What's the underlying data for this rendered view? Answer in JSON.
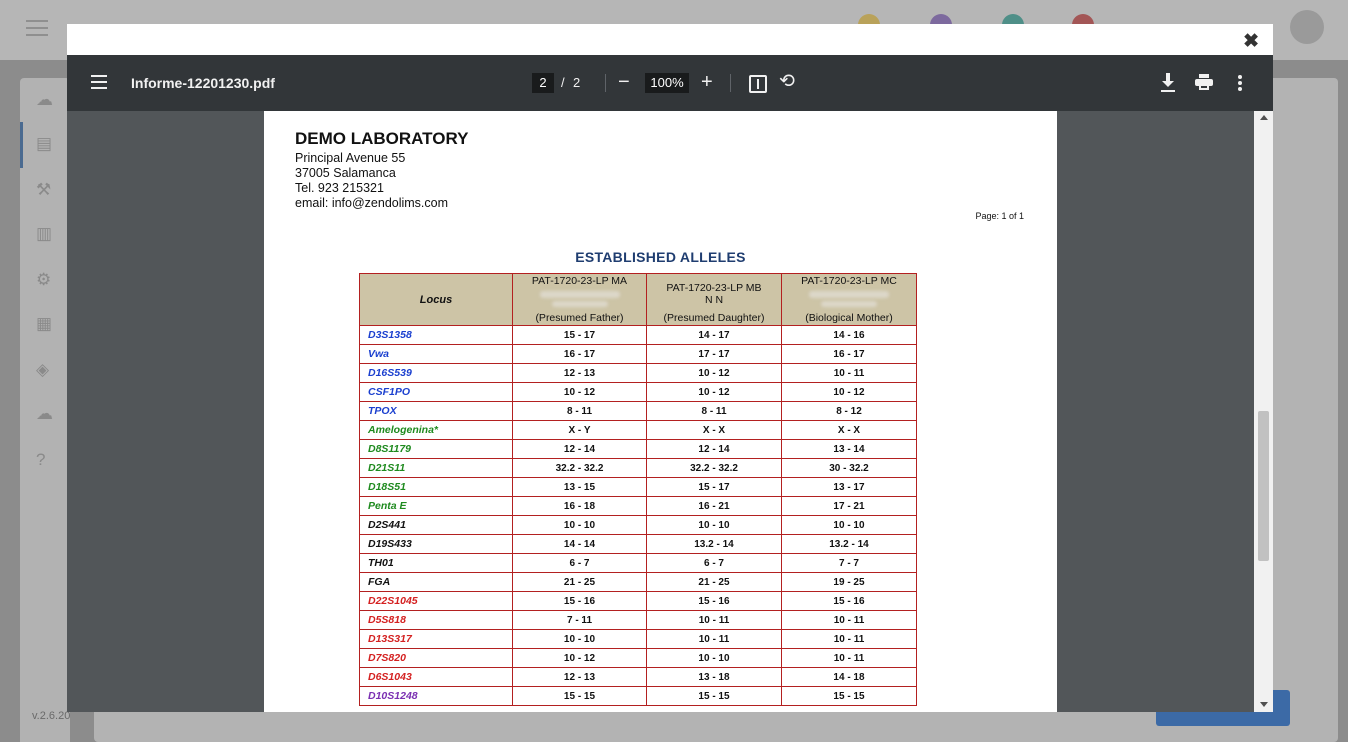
{
  "app": {
    "version": "v.2.6.20"
  },
  "viewer": {
    "file_name": "Informe-12201230.pdf",
    "current_page": "2",
    "page_separator": "/",
    "total_pages": "2",
    "zoom": "100%",
    "zoom_out_label": "−",
    "zoom_in_label": "+",
    "rotate_label": "⟲",
    "modal_close_label": "✖"
  },
  "document": {
    "lab_name": "DEMO LABORATORY",
    "address_line1": "Principal Avenue 55",
    "address_line2": "37005 Salamanca",
    "phone": "Tel. 923 215321",
    "email": "email: info@zendolims.com",
    "page_indicator": "Page: 1 of 1",
    "title": "ESTABLISHED ALLELES",
    "table": {
      "locus_header": "Locus",
      "columns": [
        {
          "sample_id": "PAT-1720-23-LP MA",
          "subline": "",
          "role": "(Presumed Father)"
        },
        {
          "sample_id": "PAT-1720-23-LP MB",
          "subline": "N N",
          "role": "(Presumed Daughter)"
        },
        {
          "sample_id": "PAT-1720-23-LP MC",
          "subline": "",
          "role": "(Biological Mother)"
        }
      ],
      "rows": [
        {
          "locus": "D3S1358",
          "color": "blue",
          "values": [
            "15 - 17",
            "14 - 17",
            "14 - 16"
          ]
        },
        {
          "locus": "Vwa",
          "color": "blue",
          "values": [
            "16 - 17",
            "17 - 17",
            "16 - 17"
          ]
        },
        {
          "locus": "D16S539",
          "color": "blue",
          "values": [
            "12 - 13",
            "10 - 12",
            "10 - 11"
          ]
        },
        {
          "locus": "CSF1PO",
          "color": "blue",
          "values": [
            "10 - 12",
            "10 - 12",
            "10 - 12"
          ]
        },
        {
          "locus": "TPOX",
          "color": "blue",
          "values": [
            "8 - 11",
            "8 - 11",
            "8 - 12"
          ]
        },
        {
          "locus": "Amelogenina*",
          "color": "green",
          "values": [
            "X - Y",
            "X - X",
            "X - X"
          ]
        },
        {
          "locus": "D8S1179",
          "color": "green",
          "values": [
            "12 - 14",
            "12 - 14",
            "13 - 14"
          ]
        },
        {
          "locus": "D21S11",
          "color": "green",
          "values": [
            "32.2 - 32.2",
            "32.2 - 32.2",
            "30 - 32.2"
          ]
        },
        {
          "locus": "D18S51",
          "color": "green",
          "values": [
            "13 - 15",
            "15 - 17",
            "13 - 17"
          ]
        },
        {
          "locus": "Penta E",
          "color": "green",
          "values": [
            "16 - 18",
            "16 - 21",
            "17 - 21"
          ]
        },
        {
          "locus": "D2S441",
          "color": "black",
          "values": [
            "10 - 10",
            "10 - 10",
            "10 - 10"
          ]
        },
        {
          "locus": "D19S433",
          "color": "black",
          "values": [
            "14 - 14",
            "13.2 - 14",
            "13.2 - 14"
          ]
        },
        {
          "locus": "TH01",
          "color": "black",
          "values": [
            "6 - 7",
            "6 - 7",
            "7 - 7"
          ]
        },
        {
          "locus": "FGA",
          "color": "black",
          "values": [
            "21 - 25",
            "21 - 25",
            "19 - 25"
          ]
        },
        {
          "locus": "D22S1045",
          "color": "red",
          "values": [
            "15 - 16",
            "15 - 16",
            "15 - 16"
          ]
        },
        {
          "locus": "D5S818",
          "color": "red",
          "values": [
            "7 - 11",
            "10 - 11",
            "10 - 11"
          ]
        },
        {
          "locus": "D13S317",
          "color": "red",
          "values": [
            "10 - 10",
            "10 - 11",
            "10 - 11"
          ]
        },
        {
          "locus": "D7S820",
          "color": "red",
          "values": [
            "10 - 12",
            "10 - 10",
            "10 - 11"
          ]
        },
        {
          "locus": "D6S1043",
          "color": "red",
          "values": [
            "12 - 13",
            "13 - 18",
            "14 - 18"
          ]
        },
        {
          "locus": "D10S1248",
          "color": "purple",
          "values": [
            "15 - 15",
            "15 - 15",
            "15 - 15"
          ]
        }
      ]
    }
  },
  "icons": {
    "menu": "hamburger-icon",
    "fit": "fit-page-icon",
    "rotate": "rotate-icon",
    "download": "download-icon",
    "print": "print-icon",
    "more": "more-vert-icon",
    "close": "close-icon"
  },
  "colors": {
    "toolbar_bg": "#323639",
    "viewer_bg": "#525659",
    "header_bg": "#cdc4a6",
    "table_border": "#b32020",
    "title_color": "#1f3d70"
  }
}
